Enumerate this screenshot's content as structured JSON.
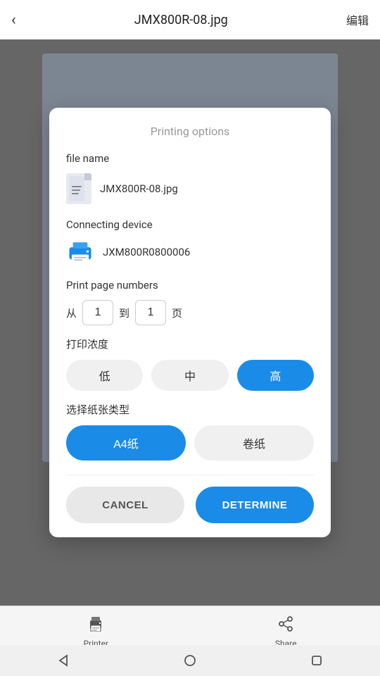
{
  "header": {
    "back_icon": "‹",
    "title": "JMX800R-08.jpg",
    "edit_label": "编辑"
  },
  "dialog": {
    "title": "Printing options",
    "file_section_label": "file name",
    "file_name": "JMX800R-08.jpg",
    "device_section_label": "Connecting device",
    "device_name": "JXM800R0800006",
    "page_numbers_label": "Print page numbers",
    "page_from_prefix": "从",
    "page_from_value": "1",
    "page_to_prefix": "到",
    "page_to_value": "1",
    "page_suffix": "页",
    "density_label": "打印浓度",
    "density_options": [
      {
        "label": "低",
        "active": false
      },
      {
        "label": "中",
        "active": false
      },
      {
        "label": "高",
        "active": true
      }
    ],
    "paper_label": "选择纸张类型",
    "paper_options": [
      {
        "label": "A4纸",
        "active": true
      },
      {
        "label": "卷纸",
        "active": false
      }
    ],
    "cancel_label": "CANCEL",
    "determine_label": "DETERMINE"
  },
  "bottom_nav": {
    "printer_label": "Printer",
    "share_label": "Share"
  },
  "system_nav": {
    "back_shape": "triangle",
    "home_shape": "circle",
    "recent_shape": "square"
  },
  "colors": {
    "accent": "#1a8ce8",
    "inactive_btn": "#f0f0f0",
    "cancel_bg": "#e8e8e8"
  }
}
